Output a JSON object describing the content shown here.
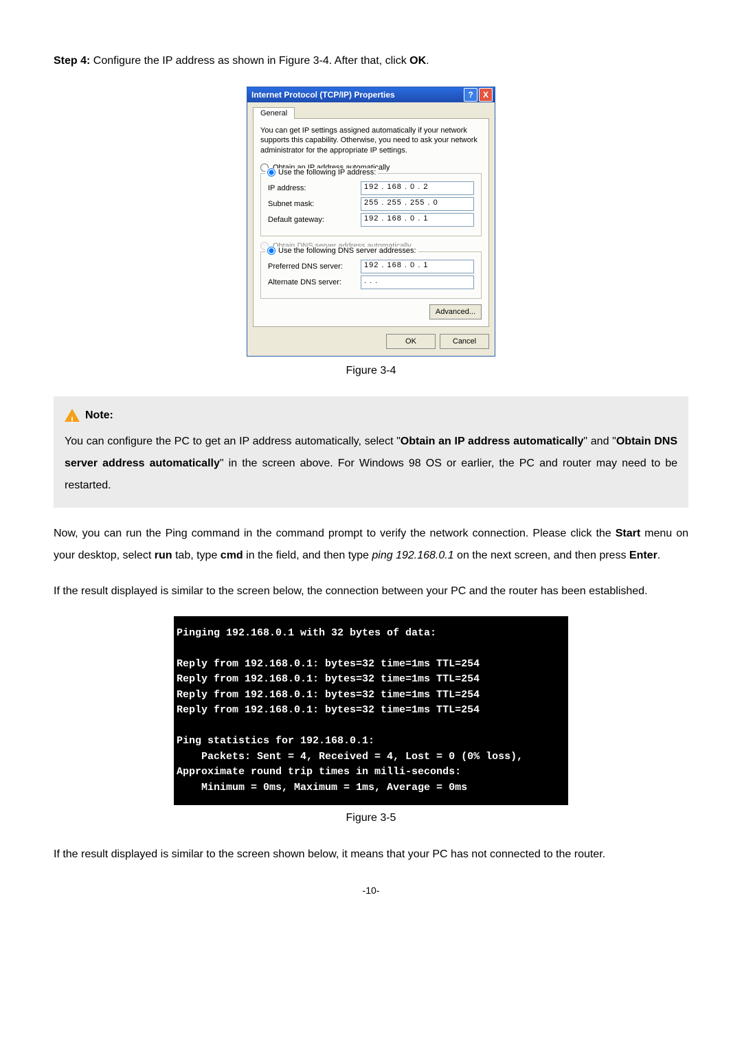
{
  "step": {
    "label": "Step 4:",
    "text1": "  Configure the IP address as shown in Figure 3-4. After that, click ",
    "ok": "OK",
    "text2": "."
  },
  "dialog": {
    "title": "Internet Protocol (TCP/IP) Properties",
    "help": "?",
    "close": "X",
    "tab": "General",
    "intro": "You can get IP settings assigned automatically if your network supports this capability. Otherwise, you need to ask your network administrator for the appropriate IP settings.",
    "radio_auto_ip": "Obtain an IP address automatically",
    "radio_use_ip": "Use the following IP address:",
    "ip_label": "IP address:",
    "ip_value": "192 . 168 .  0  .  2",
    "subnet_label": "Subnet mask:",
    "subnet_value": "255 . 255 . 255 .  0",
    "gateway_label": "Default gateway:",
    "gateway_value": "192 . 168 .  0  .  1",
    "radio_auto_dns": "Obtain DNS server address automatically",
    "radio_use_dns": "Use the following DNS server addresses:",
    "pref_dns_label": "Preferred DNS server:",
    "pref_dns_value": "192 . 168 .  0  .  1",
    "alt_dns_label": "Alternate DNS server:",
    "alt_dns_value": "  .     .     .",
    "advanced": "Advanced...",
    "ok": "OK",
    "cancel": "Cancel"
  },
  "fig1": "Figure 3-4",
  "note": {
    "head": "Note:",
    "t1": "You can configure the PC to get an IP address automatically, select \"",
    "b1": "Obtain an IP address automatically",
    "t2": "\" and \"",
    "b2": "Obtain DNS server address automatically",
    "t3": "\" in the screen above. For Windows 98 OS or earlier, the PC and router may need to be restarted."
  },
  "p1": {
    "t1": "Now, you can run the Ping command in the command prompt to verify the network connection. Please click the ",
    "b1": "Start",
    "t2": " menu on your desktop, select ",
    "b2": "run",
    "t3": " tab, type ",
    "b3": "cmd",
    "t4": " in the field, and then type ",
    "i1": "ping 192.168.0.1",
    "t5": " on the next screen, and then press ",
    "b4": "Enter",
    "t6": "."
  },
  "p2": "If the result displayed is similar to the screen below, the connection between your PC and the router has been established.",
  "cmd": "Pinging 192.168.0.1 with 32 bytes of data:\n\nReply from 192.168.0.1: bytes=32 time=1ms TTL=254\nReply from 192.168.0.1: bytes=32 time=1ms TTL=254\nReply from 192.168.0.1: bytes=32 time=1ms TTL=254\nReply from 192.168.0.1: bytes=32 time=1ms TTL=254\n\nPing statistics for 192.168.0.1:\n    Packets: Sent = 4, Received = 4, Lost = 0 (0% loss),\nApproximate round trip times in milli-seconds:\n    Minimum = 0ms, Maximum = 1ms, Average = 0ms",
  "fig2": "Figure 3-5",
  "p3": "If the result displayed is similar to the screen shown below, it means that your PC has not connected to the router.",
  "pagenum": "-10-"
}
